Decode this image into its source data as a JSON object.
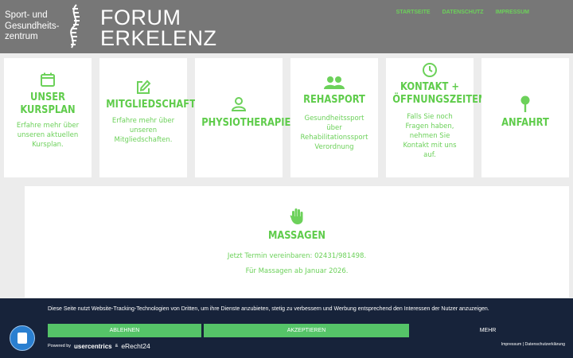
{
  "header": {
    "logo_small_line1": "Sport- und",
    "logo_small_line2": "Gesundheits-",
    "logo_small_line3": "zentrum",
    "logo_big_line1": "FORUM",
    "logo_big_line2": "ERKELENZ",
    "nav": [
      "STARTSEITE",
      "DATENSCHUTZ",
      "IMPRESSUM"
    ]
  },
  "cards": [
    {
      "icon": "calendar-icon",
      "title": [
        "UNSER",
        "KURSPLAN"
      ],
      "text": [
        "Erfahre mehr über",
        "unseren aktuellen",
        "Kursplan."
      ]
    },
    {
      "icon": "edit-icon",
      "title": [
        "MITGLIEDSCHAFTEN"
      ],
      "text": [
        "Erfahre mehr über",
        "unseren",
        "Mitgliedschaften."
      ]
    },
    {
      "icon": "user-icon",
      "title": [
        "PHYSIOTHERAPIE"
      ],
      "text": []
    },
    {
      "icon": "users-icon",
      "title": [
        "REHASPORT"
      ],
      "text": [
        "Gesundheitssport",
        "über",
        "Rehabilitationssport",
        "Verordnung"
      ]
    },
    {
      "icon": "clock-icon",
      "title": [
        "KONTAKT +",
        "ÖFFNUNGSZEITEN"
      ],
      "text": [
        "Falls Sie noch",
        "Fragen haben,",
        "nehmen Sie",
        "Kontakt mit uns",
        "auf."
      ]
    },
    {
      "icon": "pin-icon",
      "title": [
        "ANFAHRT"
      ],
      "text": []
    }
  ],
  "massage": {
    "icon": "hand-icon",
    "title": "MASSAGEN",
    "line1": "Jetzt Termin vereinbaren: 02431/981498.",
    "line2": "Für Massagen ab Januar 2026."
  },
  "cookie": {
    "text": "Diese Seite nutzt Website-Tracking-Technologien von Dritten, um ihre Dienste anzubieten, stetig zu verbessern und Werbung entsprechend den Interessen der Nutzer anzuzeigen.",
    "decline": "ABLEHNEN",
    "accept": "AKZEPTIEREN",
    "more": "MEHR",
    "powered": "Powered by",
    "usercentrics": "usercentrics",
    "amp": "&",
    "erecht": "eRecht24",
    "legal": "Impressum | Datenschutzerklärung"
  },
  "colors": {
    "accent": "#6cd15a",
    "header": "#777777",
    "banner": "#17233a",
    "button": "#55c468"
  }
}
